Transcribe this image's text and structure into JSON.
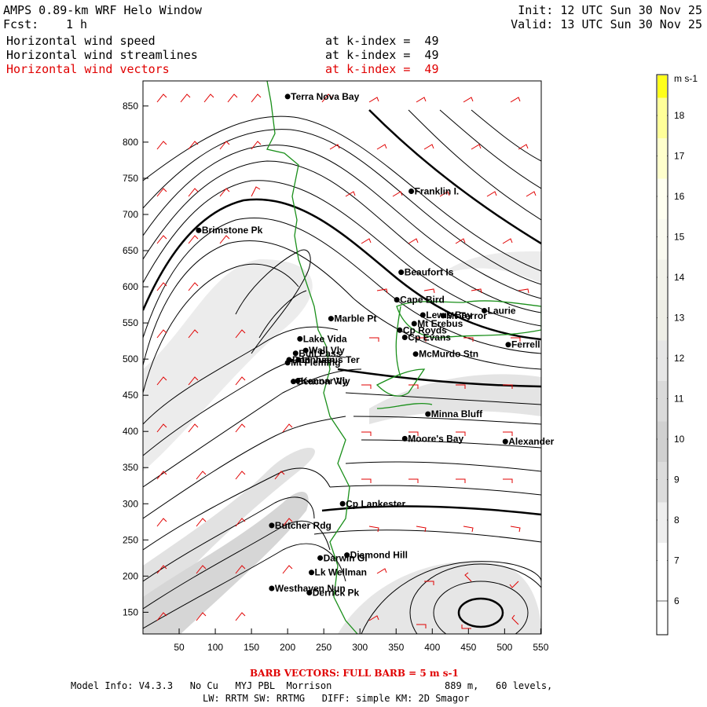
{
  "header": {
    "title": "AMPS 0.89-km WRF Helo Window",
    "fcst_label": "Fcst:",
    "fcst_value": "1 h",
    "init": "Init: 12 UTC Sun 30 Nov 25",
    "valid": "Valid: 13 UTC Sun 30 Nov 25",
    "fields": [
      {
        "name": "Horizontal wind speed",
        "level": "at k-index =  49"
      },
      {
        "name": "Horizontal wind streamlines",
        "level": "at k-index =  49"
      },
      {
        "name": "Horizontal wind vectors",
        "level": "at k-index =  49"
      }
    ]
  },
  "axes": {
    "x_ticks": [
      "50",
      "100",
      "150",
      "200",
      "250",
      "300",
      "350",
      "400",
      "450",
      "500",
      "550"
    ],
    "y_ticks": [
      "850",
      "800",
      "750",
      "700",
      "650",
      "600",
      "550",
      "500",
      "450",
      "400",
      "350",
      "300",
      "250",
      "200",
      "150"
    ]
  },
  "colorbar": {
    "unit": "m s-1",
    "levels": [
      "18",
      "17",
      "16",
      "15",
      "14",
      "13",
      "12",
      "11",
      "10",
      "9",
      "8",
      "7",
      "6"
    ]
  },
  "stations": [
    {
      "name": "Terra Nova Bay",
      "x": 200,
      "y": 863
    },
    {
      "name": "Franklin I.",
      "x": 371,
      "y": 732
    },
    {
      "name": "Brimstone Pk",
      "x": 77,
      "y": 678
    },
    {
      "name": "Beaufort Is",
      "x": 357,
      "y": 620
    },
    {
      "name": "Cape Bird",
      "x": 351,
      "y": 582
    },
    {
      "name": "Laurie",
      "x": 472,
      "y": 567
    },
    {
      "name": "Lewis Bay",
      "x": 387,
      "y": 561
    },
    {
      "name": "Mt Terror",
      "x": 415,
      "y": 560
    },
    {
      "name": "Marble Pt",
      "x": 260,
      "y": 556
    },
    {
      "name": "Cp Royds",
      "x": 355,
      "y": 540
    },
    {
      "name": "Mt Erebus",
      "x": 375,
      "y": 549
    },
    {
      "name": "Lake Vida",
      "x": 217,
      "y": 528
    },
    {
      "name": "Cp Evans",
      "x": 362,
      "y": 530
    },
    {
      "name": "Ferrell",
      "x": 505,
      "y": 520
    },
    {
      "name": "Wall Vly",
      "x": 225,
      "y": 512
    },
    {
      "name": "McMurdo Stn",
      "x": 377,
      "y": 507
    },
    {
      "name": "Bull Pass",
      "x": 211,
      "y": 508
    },
    {
      "name": "Don Juan",
      "x": 202,
      "y": 499
    },
    {
      "name": "Mt Fleming",
      "x": 200,
      "y": 495
    },
    {
      "name": "Linnaeus Ter",
      "x": 215,
      "y": 499
    },
    {
      "name": "Kennar Vly",
      "x": 214,
      "y": 470
    },
    {
      "name": "Beacon Vly",
      "x": 208,
      "y": 469
    },
    {
      "name": "Minna Bluff",
      "x": 394,
      "y": 424
    },
    {
      "name": "Moore's Bay",
      "x": 362,
      "y": 390
    },
    {
      "name": "Alexander",
      "x": 501,
      "y": 386
    },
    {
      "name": "Cp Lankester",
      "x": 276,
      "y": 300
    },
    {
      "name": "Butcher Rdg",
      "x": 178,
      "y": 270
    },
    {
      "name": "Darwin Gl",
      "x": 245,
      "y": 225
    },
    {
      "name": "Diamond Hill",
      "x": 282,
      "y": 229
    },
    {
      "name": "Lk Wellman",
      "x": 233,
      "y": 205
    },
    {
      "name": "Westhaven Nun",
      "x": 178,
      "y": 183
    },
    {
      "name": "Derrick Pk",
      "x": 230,
      "y": 177
    }
  ],
  "footer": {
    "barb_note": "BARB VECTORS: FULL BARB = 5 m s-1",
    "model_info": "Model Info: V4.3.3   No Cu   MYJ PBL  Morrison",
    "resolution": "889 m,   60 levels,",
    "physics": "LW: RRTM SW: RRTMG   DIFF: simple KM: 2D Smagor"
  },
  "colors": {
    "coast": "#1a8f1a",
    "barb": "#e00000",
    "streamline": "#000000",
    "shade_light": "#e8e8e8",
    "shade_mid": "#d4d4d4"
  }
}
